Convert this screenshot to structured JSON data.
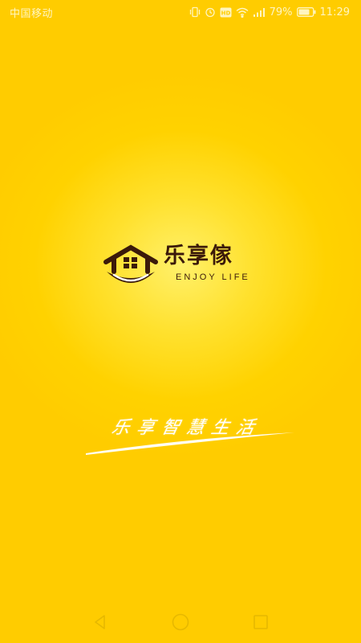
{
  "status_bar": {
    "carrier": "中国移动",
    "battery_percent": "79%",
    "time": "11:29",
    "network_badge": "HD",
    "icons": [
      "vibrate-icon",
      "alarm-icon",
      "hd-icon",
      "wifi-icon",
      "signal-icon",
      "battery-icon"
    ]
  },
  "logo": {
    "title": "乐享傢",
    "subtitle": "ENJOY LIFE",
    "icon": "house-logo-icon"
  },
  "slogan": {
    "text": "乐享智慧生活"
  },
  "nav_bar": {
    "buttons": [
      "back-icon",
      "home-icon",
      "recents-icon"
    ]
  },
  "colors": {
    "background": "#ffd200",
    "logo_brown": "#3b1a0a",
    "text_light": "#ffffff"
  }
}
